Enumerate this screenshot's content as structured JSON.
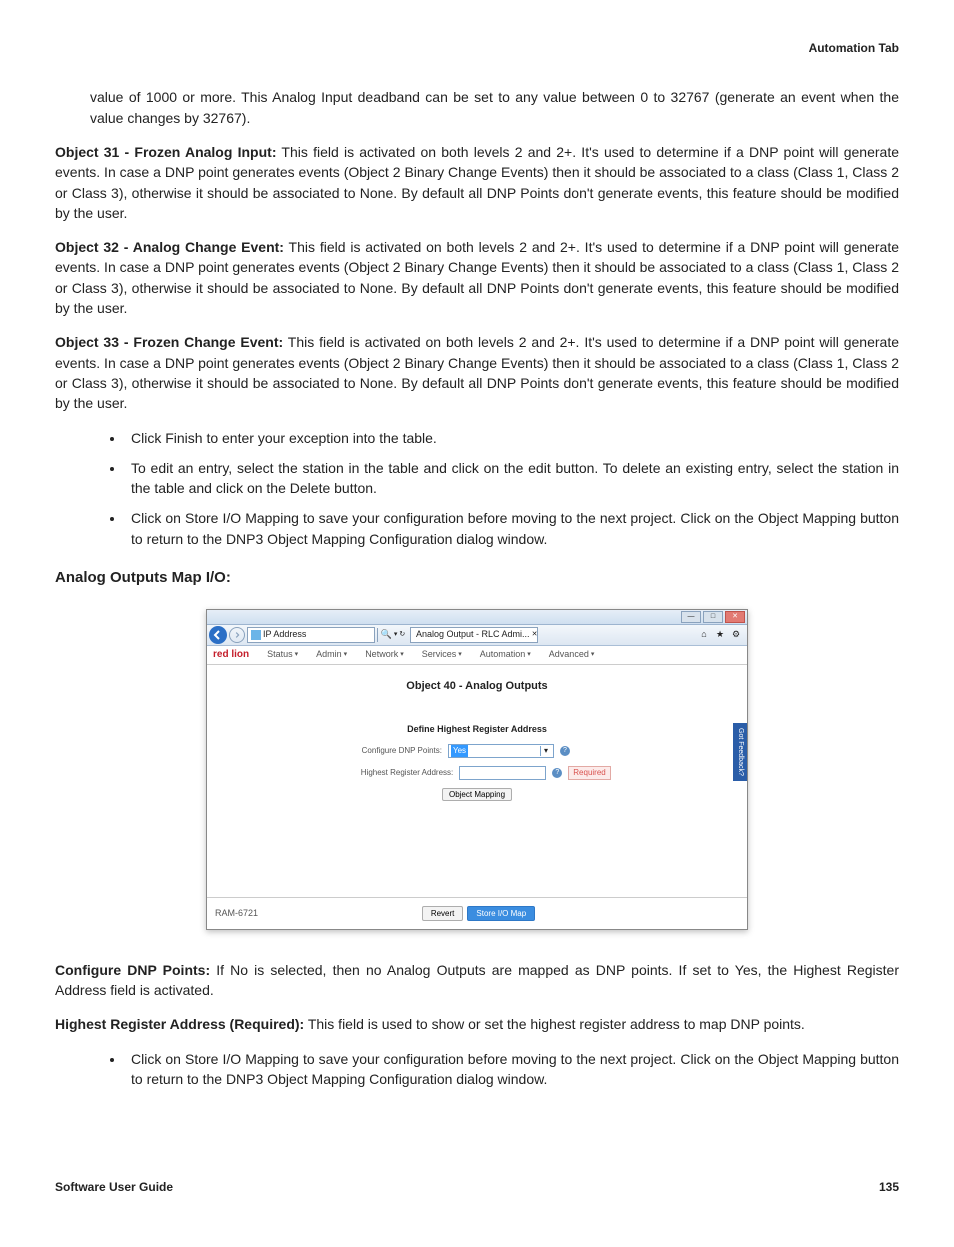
{
  "header_tab": "Automation Tab",
  "intro_para": "value of 1000 or more. This Analog Input deadband can be set to any value between 0 to 32767 (generate an event when the value changes by 32767).",
  "obj31_label": "Object 31 - Frozen Analog Input:",
  "obj31_text": " This field is activated on both levels 2 and 2+. It's used to determine if a DNP point will generate events. In case a DNP point generates events (Object 2 Binary Change Events) then it should be associated to a class (Class 1, Class 2 or Class 3), otherwise it should be associated to None. By default all DNP Points don't generate events, this feature should be modified by the user.",
  "obj32_label": "Object 32 - Analog Change Event:",
  "obj32_text": " This field is activated on both levels 2 and 2+. It's used to determine if a DNP point will generate events. In case a DNP point generates events (Object 2 Binary Change Events) then it should be associated to a class (Class 1, Class 2 or Class 3), otherwise it should be associated to None. By default all DNP Points don't generate events, this feature should be modified by the user.",
  "obj33_label": "Object 33 - Frozen Change Event:",
  "obj33_text": " This field is activated on both levels 2 and 2+. It's used to determine if a DNP point will generate events. In case a DNP point generates events (Object 2 Binary Change Events) then it should be associated to a class (Class 1, Class 2 or Class 3), otherwise it should be associated to None. By default all DNP Points don't generate events, this feature should be modified by the user.",
  "bullets1": [
    "Click Finish to enter your exception into the table.",
    "To edit an entry, select the station in the table and click on the edit button. To delete an existing entry, select the station in the table and click on the Delete button.",
    "Click on Store I/O Mapping to save your configuration before moving to the next project. Click on the Object Mapping button to return to the DNP3 Object Mapping Configuration dialog window."
  ],
  "section_heading": "Analog Outputs Map I/O:",
  "window": {
    "address_text": "IP Address",
    "tab_title": "Analog Output - RLC Admi...",
    "logo": "red lion",
    "nav": [
      "Status",
      "Admin",
      "Network",
      "Services",
      "Automation",
      "Advanced"
    ],
    "page_title": "Object 40 - Analog Outputs",
    "form_heading": "Define Highest Register Address",
    "row1_label": "Configure DNP Points:",
    "row1_value": "Yes",
    "row2_label": "Highest Register Address:",
    "required": "Required",
    "obj_map_btn": "Object Mapping",
    "model": "RAM-6721",
    "revert": "Revert",
    "store": "Store I/O Map",
    "feedback": "Got Feedback?"
  },
  "cfg_label": "Configure DNP Points:",
  "cfg_text": " If No is selected, then no Analog Outputs are mapped as DNP points. If set to Yes, the Highest Register Address field is activated.",
  "hra_label": "Highest Register Address (Required):",
  "hra_text": " This field is used to show or set the highest register address to map DNP points.",
  "bullets2": [
    "Click on Store I/O Mapping to save your configuration before moving to the next project. Click on the Object Mapping button to return to the DNP3 Object Mapping Configuration dialog window."
  ],
  "footer_left": "Software User Guide",
  "footer_right": "135"
}
